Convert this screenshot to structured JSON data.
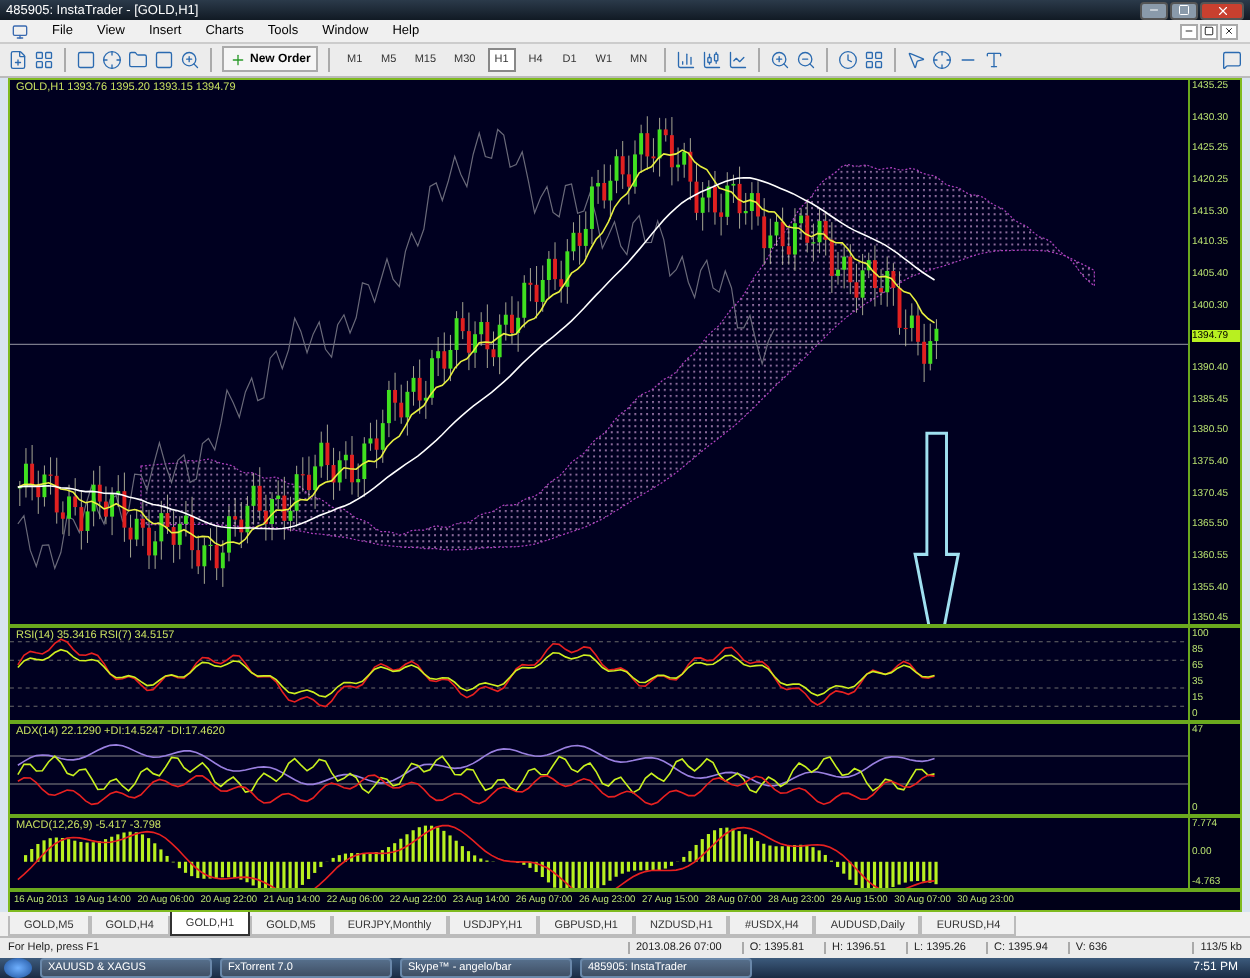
{
  "window": {
    "title": "485905: InstaTrader - [GOLD,H1]"
  },
  "menu": [
    "File",
    "View",
    "Insert",
    "Charts",
    "Tools",
    "Window",
    "Help"
  ],
  "toolbar": {
    "new_order": "New Order",
    "timeframes": [
      {
        "label": "M1",
        "selected": false
      },
      {
        "label": "M5",
        "selected": false
      },
      {
        "label": "M15",
        "selected": false
      },
      {
        "label": "M30",
        "selected": false
      },
      {
        "label": "H1",
        "selected": true
      },
      {
        "label": "H4",
        "selected": false
      },
      {
        "label": "D1",
        "selected": false
      },
      {
        "label": "W1",
        "selected": false
      },
      {
        "label": "MN",
        "selected": false
      }
    ]
  },
  "main_chart": {
    "header": "GOLD,H1  1393.76 1395.20 1393.15 1394.79",
    "price_axis": [
      {
        "text": "1435.25",
        "kind": "tick"
      },
      {
        "text": "1430.30",
        "kind": "tick"
      },
      {
        "text": "1425.25",
        "kind": "tick"
      },
      {
        "text": "1420.25",
        "kind": "tick"
      },
      {
        "text": "1415.30",
        "kind": "tick"
      },
      {
        "text": "1410.35",
        "kind": "tick"
      },
      {
        "text": "1405.40",
        "kind": "tick"
      },
      {
        "text": "1400.30",
        "kind": "tick"
      },
      {
        "text": "1394.79",
        "kind": "current"
      },
      {
        "text": "1390.40",
        "kind": "tick"
      },
      {
        "text": "1385.45",
        "kind": "tick"
      },
      {
        "text": "1380.50",
        "kind": "tick"
      },
      {
        "text": "1375.40",
        "kind": "tick"
      },
      {
        "text": "1370.45",
        "kind": "tick"
      },
      {
        "text": "1365.50",
        "kind": "tick"
      },
      {
        "text": "1360.55",
        "kind": "tick"
      },
      {
        "text": "1355.40",
        "kind": "tick"
      },
      {
        "text": "1350.45",
        "kind": "tick"
      }
    ]
  },
  "indicators": [
    {
      "kind": "rsi",
      "header": "RSI(14) 35.3416  RSI(7) 34.5157",
      "axis": [
        "100",
        "85",
        "65",
        "35",
        "15",
        "0"
      ]
    },
    {
      "kind": "adx",
      "header": "ADX(14) 22.1290 +DI:14.5247 -DI:17.4620",
      "axis": [
        "47",
        "0"
      ]
    },
    {
      "kind": "macd",
      "header": "MACD(12,26,9) -5.417 -3.798",
      "axis": [
        "7.774",
        "0.00",
        "-4.763"
      ]
    }
  ],
  "time_axis": [
    "16 Aug 2013",
    "19 Aug 14:00",
    "20 Aug 06:00",
    "20 Aug 22:00",
    "21 Aug 14:00",
    "22 Aug 06:00",
    "22 Aug 22:00",
    "23 Aug 14:00",
    "26 Aug 07:00",
    "26 Aug 23:00",
    "27 Aug 15:00",
    "28 Aug 07:00",
    "28 Aug 23:00",
    "29 Aug 15:00",
    "30 Aug 07:00",
    "30 Aug 23:00"
  ],
  "chart_tabs": [
    {
      "label": "GOLD,M5",
      "selected": false
    },
    {
      "label": "GOLD,H4",
      "selected": false
    },
    {
      "label": "GOLD,H1",
      "selected": true
    },
    {
      "label": "GOLD,M5",
      "selected": false
    },
    {
      "label": "EURJPY,Monthly",
      "selected": false
    },
    {
      "label": "USDJPY,H1",
      "selected": false
    },
    {
      "label": "GBPUSD,H1",
      "selected": false
    },
    {
      "label": "NZDUSD,H1",
      "selected": false
    },
    {
      "label": "#USDX,H4",
      "selected": false
    },
    {
      "label": "AUDUSD,Daily",
      "selected": false
    },
    {
      "label": "EURUSD,H4",
      "selected": false
    }
  ],
  "status_bar": {
    "help": "For Help, press F1",
    "fields": [
      "2013.08.26 07:00",
      "O: 1395.81",
      "H: 1396.51",
      "L: 1395.26",
      "C: 1395.94",
      "V: 636"
    ],
    "traffic": "113/5 kb"
  },
  "taskbar": {
    "items": [
      "XAUUSD & XAGUS",
      "FxTorrent 7.0",
      "Skype™ - angelo/bar",
      "485905: InstaTrader"
    ],
    "clock": "7:51 PM"
  }
}
